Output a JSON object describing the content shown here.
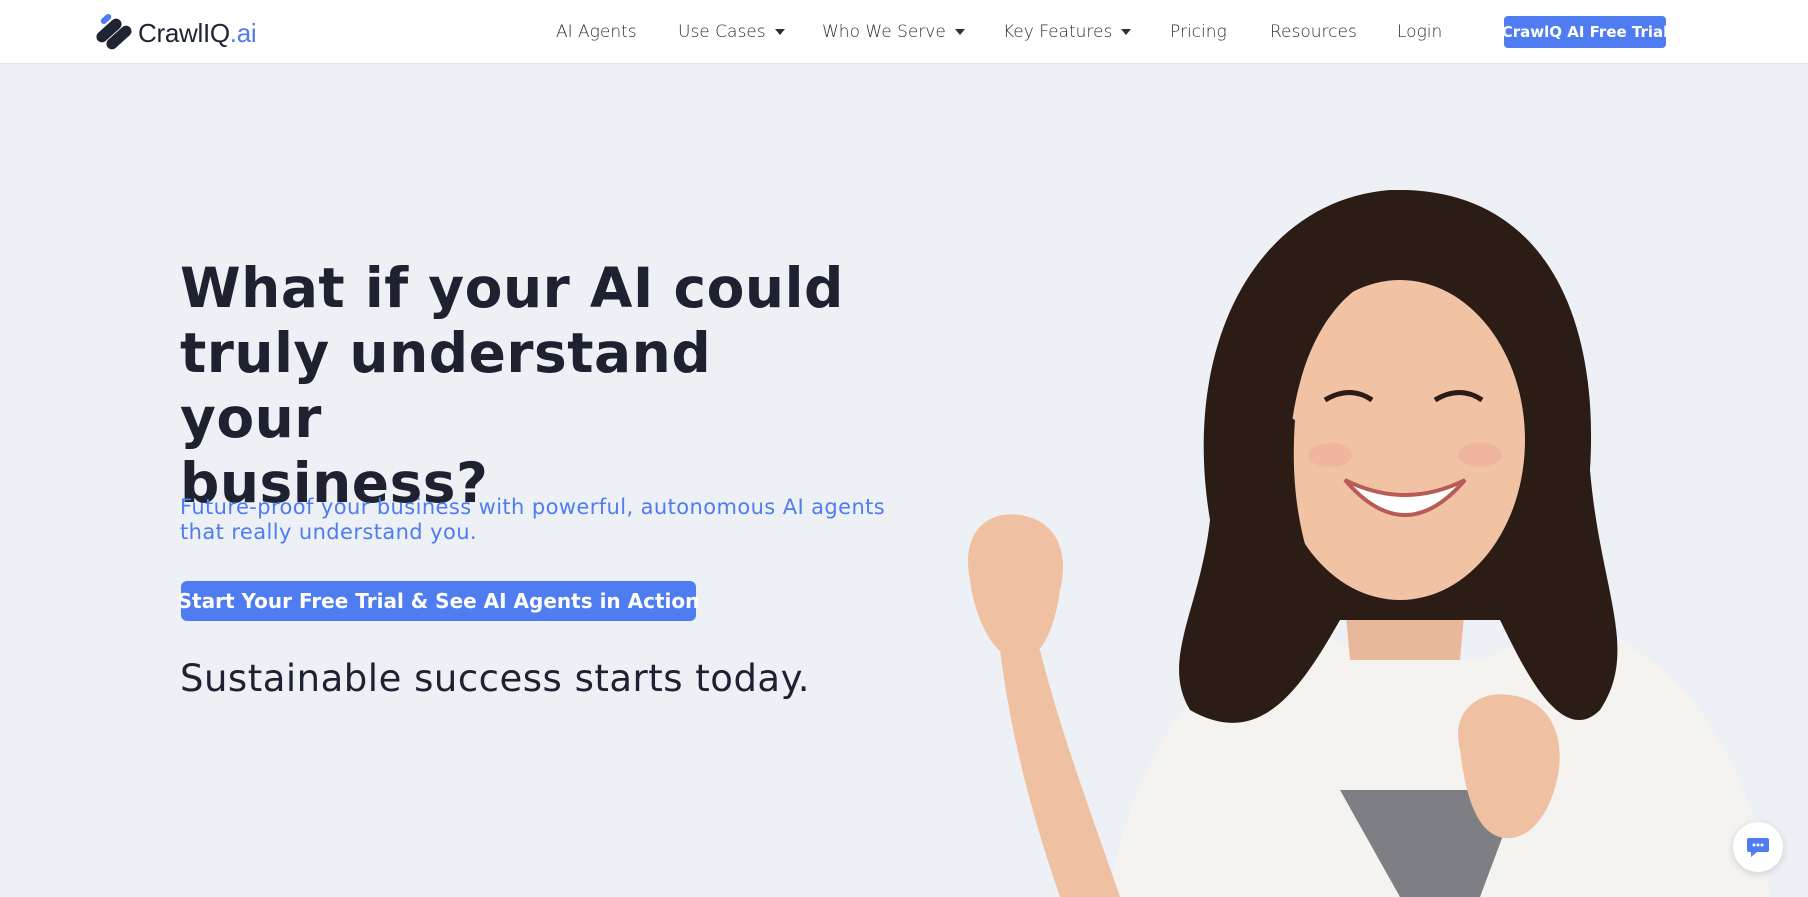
{
  "header": {
    "logo_text_main": "CrawlIQ",
    "logo_text_suffix": ".ai",
    "nav": [
      {
        "label": "AI Agents",
        "has_dropdown": false
      },
      {
        "label": "Use Cases",
        "has_dropdown": true
      },
      {
        "label": "Who We Serve",
        "has_dropdown": true
      },
      {
        "label": "Key Features",
        "has_dropdown": true
      },
      {
        "label": "Pricing",
        "has_dropdown": false
      },
      {
        "label": "Resources",
        "has_dropdown": false
      },
      {
        "label": "Login",
        "has_dropdown": false
      }
    ],
    "trial_button": "CrawlQ AI Free Trial"
  },
  "hero": {
    "title_line1": "What if your AI could",
    "title_line2": "truly understand your",
    "title_line3": "business?",
    "subtitle_line1": "Future-proof your business with powerful, autonomous AI agents",
    "subtitle_line2": "that really understand you.",
    "cta": "Start Your Free Trial & See AI Agents in Action",
    "tagline": "Sustainable success starts today."
  },
  "colors": {
    "accent": "#4f7cf0",
    "background": "#edf1f6",
    "heading": "#1d2130"
  },
  "icons": {
    "logo": "logo-mark-icon",
    "chat": "chat-icon"
  }
}
